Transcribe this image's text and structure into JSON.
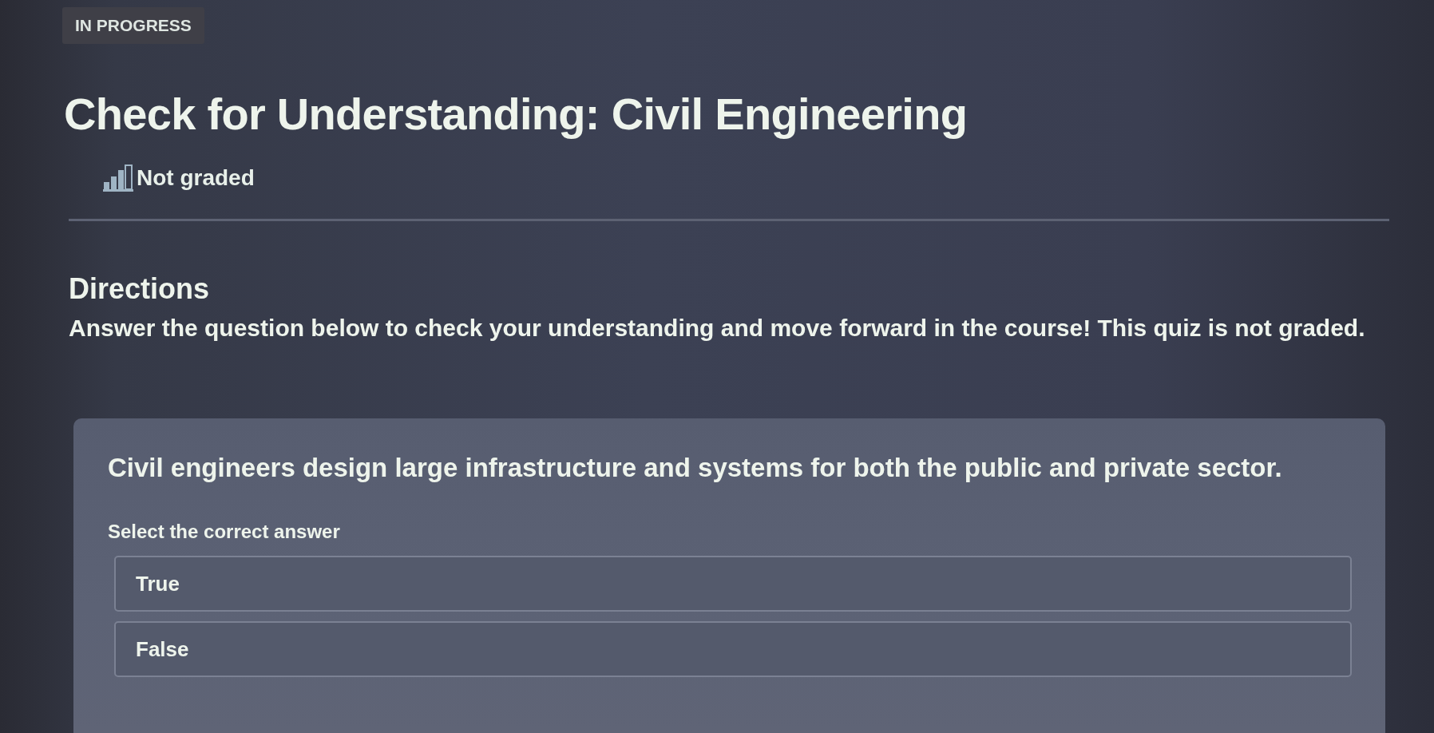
{
  "status_badge": "IN PROGRESS",
  "title": "Check for Understanding: Civil Engineering",
  "grading": {
    "label": "Not graded"
  },
  "directions": {
    "heading": "Directions",
    "text": "Answer the question below to check your understanding and move forward in the course! This quiz is not graded."
  },
  "question": {
    "prompt": "Civil engineers design large infrastructure and systems for both the public and private sector.",
    "instruction": "Select the correct answer",
    "options": [
      {
        "label": "True",
        "selected": false
      },
      {
        "label": "False",
        "selected": false
      }
    ]
  }
}
